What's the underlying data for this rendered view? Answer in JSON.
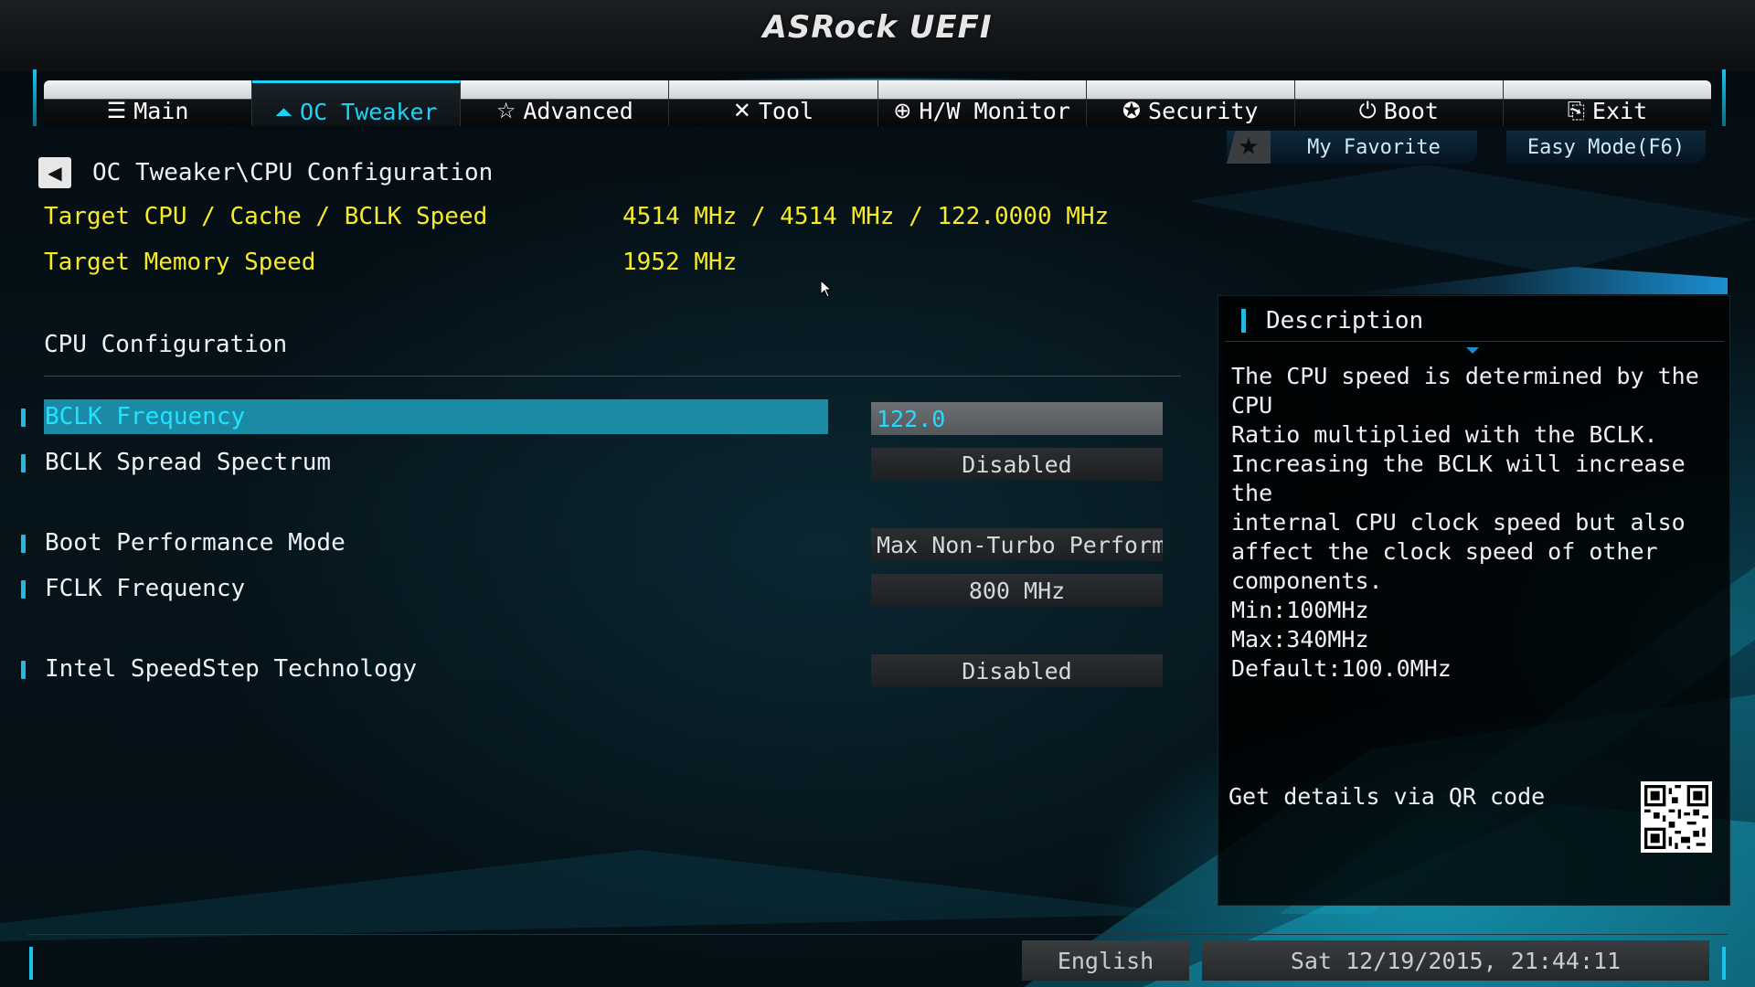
{
  "app": {
    "logo": "ASRock UEFI"
  },
  "tabs": [
    {
      "label": "Main",
      "icon": "list-icon",
      "glyph": "☰",
      "active": false
    },
    {
      "label": "OC Tweaker",
      "icon": "rocket-icon",
      "glyph": "⏶",
      "active": true
    },
    {
      "label": "Advanced",
      "icon": "star-icon",
      "glyph": "☆",
      "active": false
    },
    {
      "label": "Tool",
      "icon": "tools-icon",
      "glyph": "✕",
      "active": false
    },
    {
      "label": "H/W Monitor",
      "icon": "crosshair-icon",
      "glyph": "⊕",
      "active": false
    },
    {
      "label": "Security",
      "icon": "shield-icon",
      "glyph": "✪",
      "active": false
    },
    {
      "label": "Boot",
      "icon": "power-icon",
      "glyph": "⏻",
      "active": false
    },
    {
      "label": "Exit",
      "icon": "exit-door-icon",
      "glyph": "⎘",
      "active": false
    }
  ],
  "favorite": {
    "label": "My Favorite",
    "icon": "star-icon"
  },
  "easy_mode": {
    "label": "Easy Mode(F6)"
  },
  "breadcrumb": {
    "path": "OC Tweaker\\CPU Configuration",
    "back_icon": "back-arrow-icon"
  },
  "info": {
    "target_cpu_label": "Target CPU / Cache / BCLK Speed",
    "target_cpu_value": "4514 MHz / 4514 MHz / 122.0000 MHz",
    "target_mem_label": "Target Memory Speed",
    "target_mem_value": "1952 MHz"
  },
  "section": {
    "title": "CPU Configuration"
  },
  "settings": {
    "bclk_frequency": {
      "label": "BCLK Frequency",
      "value": "122.0"
    },
    "bclk_spread": {
      "label": "BCLK Spread Spectrum",
      "value": "Disabled"
    },
    "boot_perf": {
      "label": "Boot Performance Mode",
      "value": "Max Non-Turbo Perform..."
    },
    "fclk": {
      "label": "FCLK Frequency",
      "value": "800 MHz"
    },
    "speedstep": {
      "label": "Intel SpeedStep Technology",
      "value": "Disabled"
    }
  },
  "description": {
    "title": "Description",
    "body": "The CPU speed is determined by the CPU\nRatio multiplied with the BCLK.\nIncreasing the BCLK will increase the\ninternal CPU clock speed but also\naffect the clock speed of other\ncomponents.\nMin:100MHz\nMax:340MHz\nDefault:100.0MHz",
    "qr_text": "Get details via QR code"
  },
  "footer": {
    "language": "English",
    "datetime": "Sat 12/19/2015, 21:44:11"
  },
  "colors": {
    "accent": "#1cd2f5",
    "highlight_row": "#1a8aa5",
    "info_yellow": "#f6ea2a"
  }
}
